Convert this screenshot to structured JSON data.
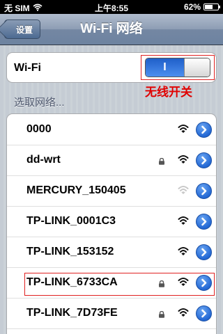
{
  "status": {
    "carrier": "无 SIM",
    "time": "上午8:55",
    "battery": "62%",
    "battery_level": 0.62
  },
  "nav": {
    "back_label": "设置",
    "title": "Wi-Fi 网络"
  },
  "wifi": {
    "label": "Wi-Fi",
    "toggle_on_label": "I",
    "enabled": true
  },
  "annotation": "无线开关",
  "section": {
    "header": "选取网络..."
  },
  "networks": [
    {
      "name": "0000",
      "locked": false,
      "signal": "strong",
      "icon": "wifi-icon"
    },
    {
      "name": "dd-wrt",
      "locked": true,
      "signal": "strong",
      "icon": "wifi-icon"
    },
    {
      "name": "MERCURY_150405",
      "locked": false,
      "signal": "weak",
      "icon": "wifi-icon"
    },
    {
      "name": "TP-LINK_0001C3",
      "locked": false,
      "signal": "strong",
      "icon": "wifi-icon"
    },
    {
      "name": "TP-LINK_153152",
      "locked": false,
      "signal": "strong",
      "icon": "wifi-icon"
    },
    {
      "name": "TP-LINK_6733CA",
      "locked": true,
      "signal": "strong",
      "icon": "wifi-icon"
    },
    {
      "name": "TP-LINK_7D73FE",
      "locked": true,
      "signal": "strong",
      "icon": "wifi-icon"
    }
  ],
  "colors": {
    "accent": "#2368d4",
    "annotation": "#e00000",
    "nav": "#6d83a0"
  }
}
